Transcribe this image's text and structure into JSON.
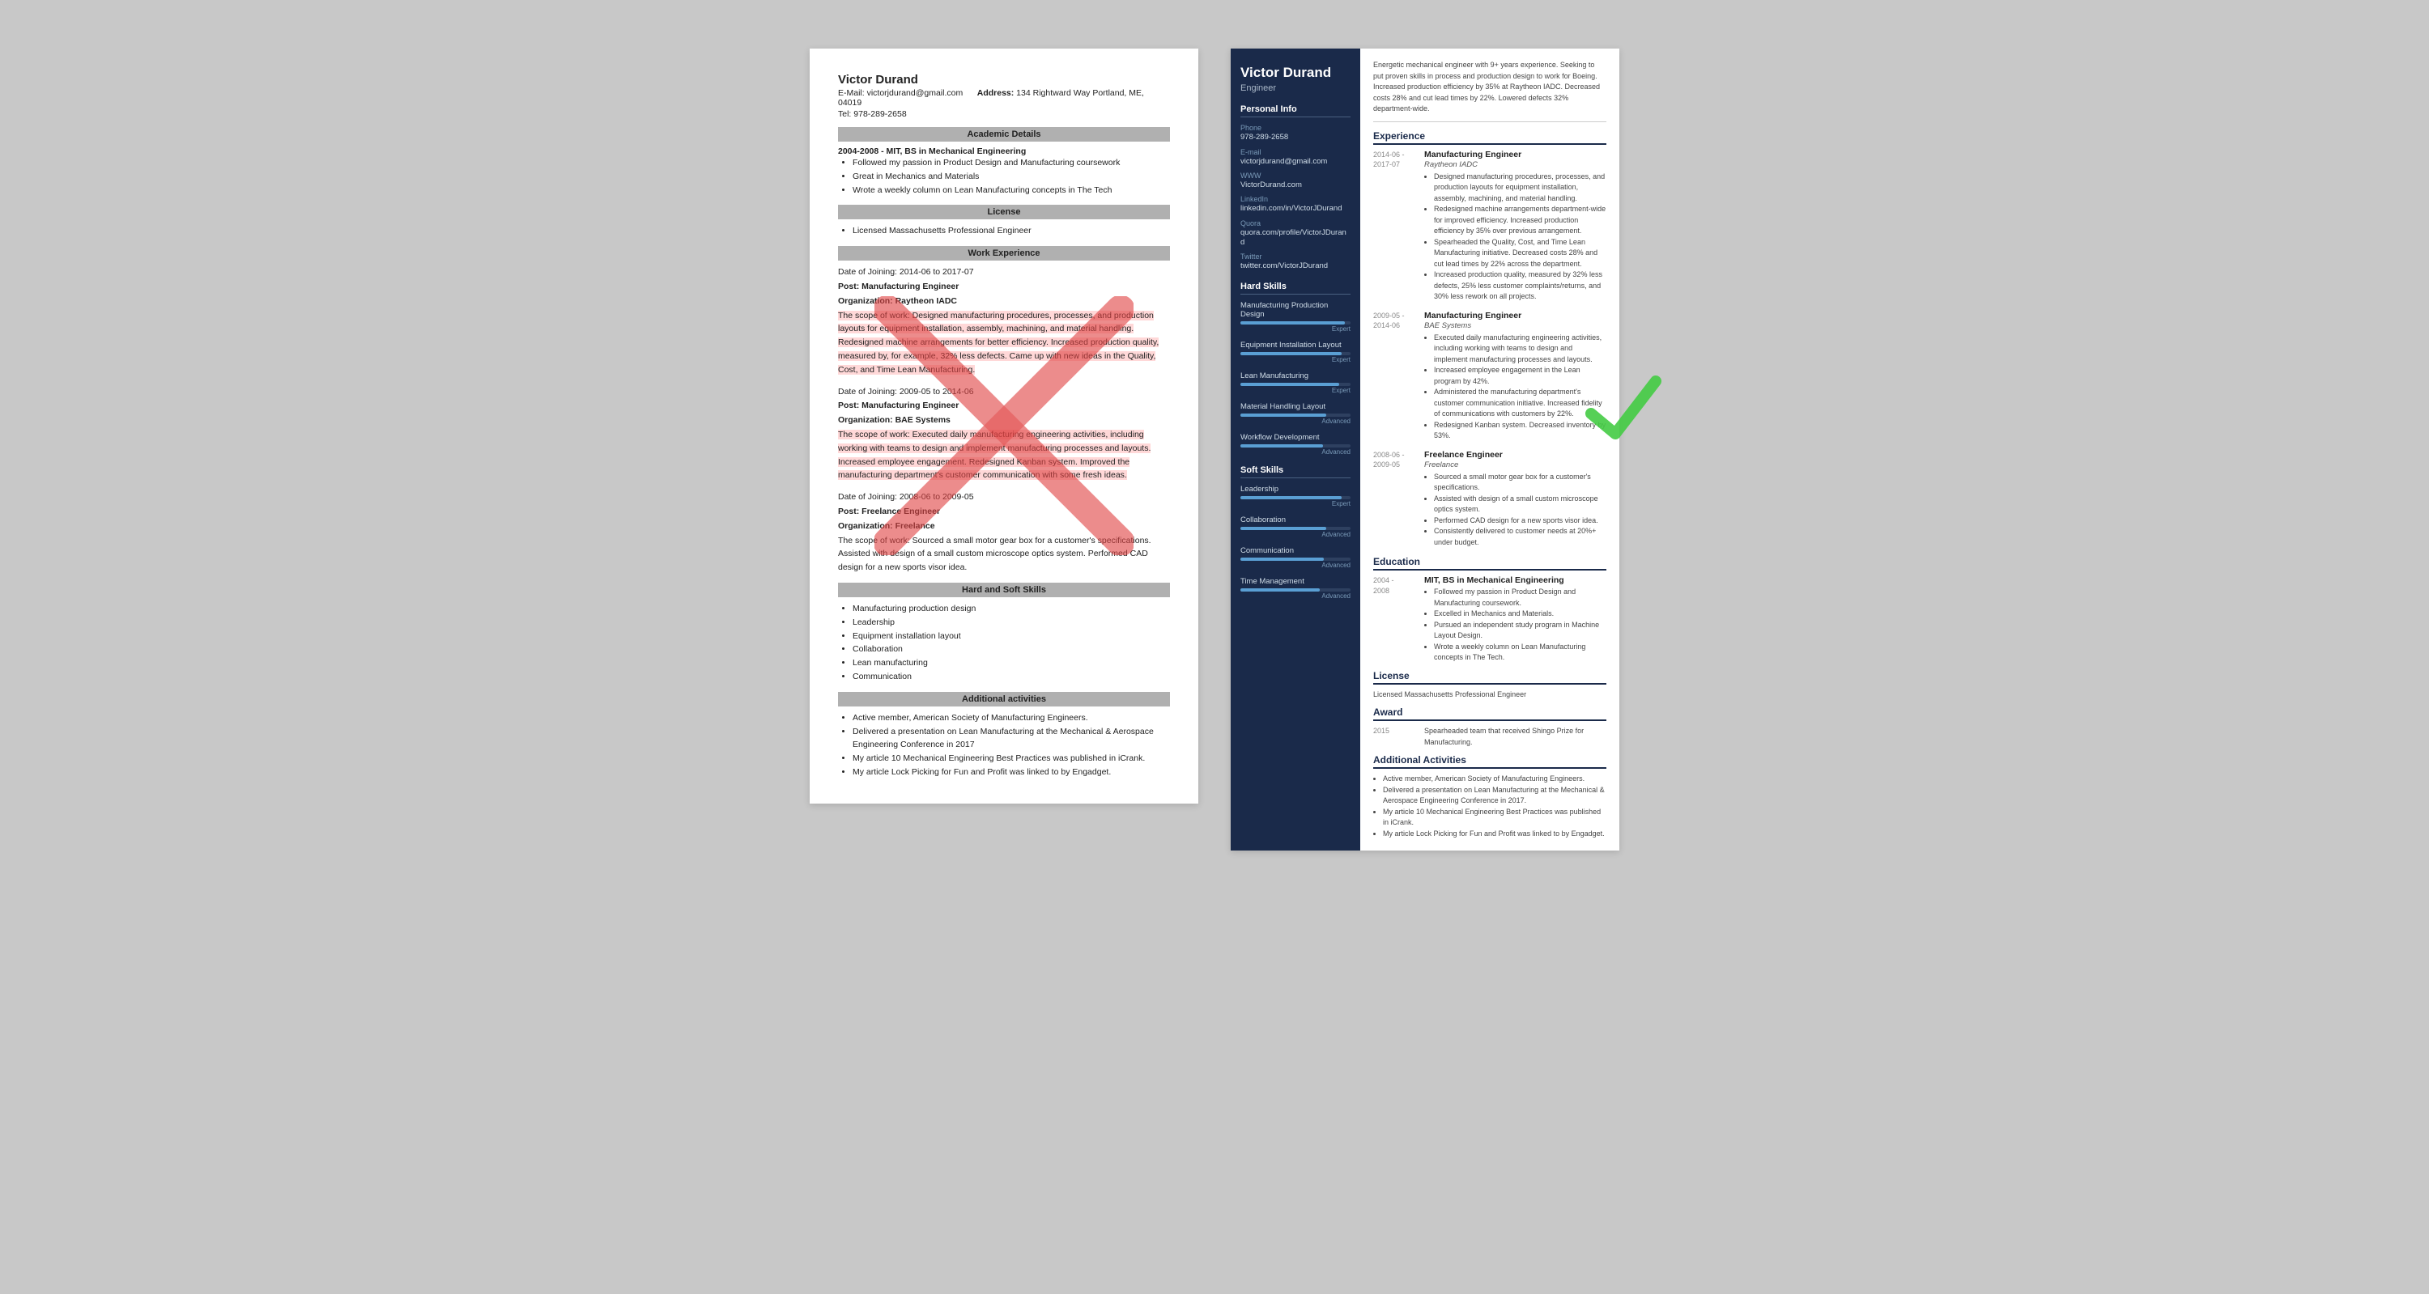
{
  "left_resume": {
    "name": "Victor Durand",
    "email_label": "E-Mail:",
    "email": "victorjdurand@gmail.com",
    "address_label": "Address:",
    "address": "134 Rightward Way Portland, ME, 04019",
    "tel_label": "Tel:",
    "tel": "978-289-2658",
    "sections": {
      "academic": {
        "header": "Academic Details",
        "degree": "2004-2008 - MIT, BS in Mechanical Engineering",
        "bullets": [
          "Followed my passion in Product Design and Manufacturing coursework",
          "Great in Mechanics and Materials",
          "Wrote a weekly column on Lean Manufacturing concepts in The Tech"
        ]
      },
      "license": {
        "header": "License",
        "items": [
          "Licensed Massachusetts Professional Engineer"
        ]
      },
      "work": {
        "header": "Work Experience",
        "jobs": [
          {
            "date": "Date of Joining: 2014-06 to 2017-07",
            "post": "Post: Manufacturing Engineer",
            "org": "Organization: Raytheon IADC",
            "scope": "The scope of work: Designed manufacturing procedures, processes, and production layouts for equipment installation, assembly, machining, and material handling. Redesigned machine arrangements for better efficiency. Increased production quality, measured by, for example, 32% less defects. Came up with new ideas in the Quality, Cost, and Time Lean Manufacturing."
          },
          {
            "date": "Date of Joining: 2009-05 to 2014-06",
            "post": "Post: Manufacturing Engineer",
            "org": "Organization: BAE Systems",
            "scope": "The scope of work: Executed daily manufacturing engineering activities, including working with teams to design and implement manufacturing processes and layouts. Increased employee engagement. Redesigned Kanban system. Improved the manufacturing department's customer communication with some fresh ideas."
          },
          {
            "date": "Date of Joining: 2008-06 to 2009-05",
            "post": "Post: Freelance Engineer",
            "org": "Organization: Freelance",
            "scope": "The scope of work: Sourced a small motor gear box for a customer's specifications. Assisted with design of a small custom microscope optics system. Performed CAD design for a new sports visor idea."
          }
        ]
      },
      "hard_soft": {
        "header": "Hard and Soft Skills",
        "items": [
          "Manufacturing production design",
          "Leadership",
          "Equipment installation layout",
          "Collaboration",
          "Lean manufacturing",
          "Communication"
        ]
      },
      "additional": {
        "header": "Additional activities",
        "items": [
          "Active member, American Society of Manufacturing Engineers.",
          "Delivered a presentation on Lean Manufacturing at the Mechanical & Aerospace Engineering Conference in 2017",
          "My article 10 Mechanical Engineering Best Practices was published in iCrank.",
          "My article Lock Picking for Fun and Profit was linked to by Engadget."
        ]
      }
    }
  },
  "right_resume": {
    "name": "Victor Durand",
    "title": "Engineer",
    "summary": "Energetic mechanical engineer with 9+ years experience. Seeking to put proven skills in process and production design to work for Boeing. Increased production efficiency by 35% at Raytheon IADC. Decreased costs 28% and cut lead times by 22%. Lowered defects 32% department-wide.",
    "personal_info": {
      "section_title": "Personal Info",
      "phone_label": "Phone",
      "phone": "978-289-2658",
      "email_label": "E-mail",
      "email": "victorjdurand@gmail.com",
      "www_label": "WWW",
      "www": "VictorDurand.com",
      "linkedin_label": "LinkedIn",
      "linkedin": "linkedin.com/in/VictorJDurand",
      "quora_label": "Quora",
      "quora": "quora.com/profile/VictorJDurand",
      "twitter_label": "Twitter",
      "twitter": "twitter.com/VictorJDurand"
    },
    "hard_skills": {
      "section_title": "Hard Skills",
      "skills": [
        {
          "name": "Manufacturing Production Design",
          "level": "Expert",
          "pct": 95
        },
        {
          "name": "Equipment Installation Layout",
          "level": "Expert",
          "pct": 92
        },
        {
          "name": "Lean Manufacturing",
          "level": "Expert",
          "pct": 90
        },
        {
          "name": "Material Handling Layout",
          "level": "Advanced",
          "pct": 78
        },
        {
          "name": "Workflow Development",
          "level": "Advanced",
          "pct": 75
        }
      ]
    },
    "soft_skills": {
      "section_title": "Soft Skills",
      "skills": [
        {
          "name": "Leadership",
          "level": "Expert",
          "pct": 92
        },
        {
          "name": "Collaboration",
          "level": "Advanced",
          "pct": 78
        },
        {
          "name": "Communication",
          "level": "Advanced",
          "pct": 76
        },
        {
          "name": "Time Management",
          "level": "Advanced",
          "pct": 72
        }
      ]
    },
    "experience": {
      "section_title": "Experience",
      "jobs": [
        {
          "date_start": "2014-06 -",
          "date_end": "2017-07",
          "title": "Manufacturing Engineer",
          "org": "Raytheon IADC",
          "bullets": [
            "Designed manufacturing procedures, processes, and production layouts for equipment installation, assembly, machining, and material handling.",
            "Redesigned machine arrangements department-wide for improved efficiency. Increased production efficiency by 35% over previous arrangement.",
            "Spearheaded the Quality, Cost, and Time Lean Manufacturing initiative. Decreased costs 28% and cut lead times by 22% across the department.",
            "Increased production quality, measured by 32% less defects, 25% less customer complaints/returns, and 30% less rework on all projects."
          ]
        },
        {
          "date_start": "2009-05 -",
          "date_end": "2014-06",
          "title": "Manufacturing Engineer",
          "org": "BAE Systems",
          "bullets": [
            "Executed daily manufacturing engineering activities, including working with teams to design and implement manufacturing processes and layouts.",
            "Increased employee engagement in the Lean program by 42%.",
            "Administered the manufacturing department's customer communication initiative. Increased fidelity of communications with customers by 22%.",
            "Redesigned Kanban system. Decreased inventory by 53%."
          ]
        },
        {
          "date_start": "2008-06 -",
          "date_end": "2009-05",
          "title": "Freelance Engineer",
          "org": "Freelance",
          "bullets": [
            "Sourced a small motor gear box for a customer's specifications.",
            "Assisted with design of a small custom microscope optics system.",
            "Performed CAD design for a new sports visor idea.",
            "Consistently delivered to customer needs at 20%+ under budget."
          ]
        }
      ]
    },
    "education": {
      "section_title": "Education",
      "items": [
        {
          "date_start": "2004 -",
          "date_end": "2008",
          "degree": "MIT, BS in Mechanical Engineering",
          "bullets": [
            "Followed my passion in Product Design and Manufacturing coursework.",
            "Excelled in Mechanics and Materials.",
            "Pursued an independent study program in Machine Layout Design.",
            "Wrote a weekly column on Lean Manufacturing concepts in The Tech."
          ]
        }
      ]
    },
    "license": {
      "section_title": "License",
      "text": "Licensed Massachusetts Professional Engineer"
    },
    "award": {
      "section_title": "Award",
      "year": "2015",
      "text": "Spearheaded team that received Shingo Prize for Manufacturing."
    },
    "additional": {
      "section_title": "Additional Activities",
      "items": [
        "Active member, American Society of Manufacturing Engineers.",
        "Delivered a presentation on Lean Manufacturing at the Mechanical & Aerospace Engineering Conference in 2017.",
        "My article 10 Mechanical Engineering Best Practices was published in iCrank.",
        "My article Lock Picking for Fun and Profit was linked to by Engadget."
      ]
    }
  }
}
